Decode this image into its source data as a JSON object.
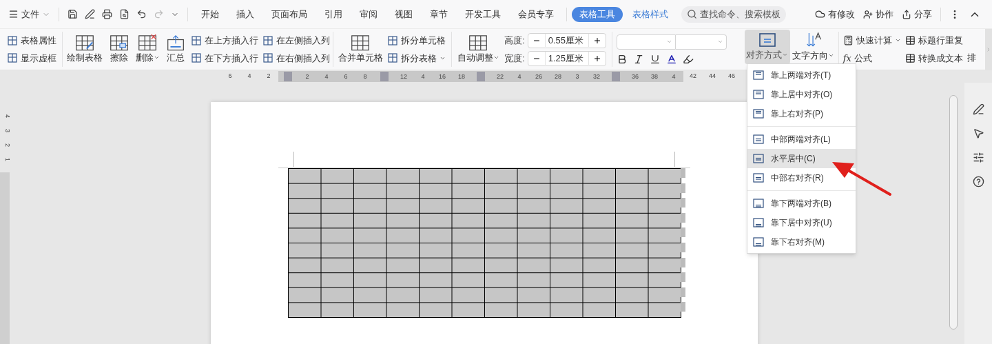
{
  "menu": {
    "file": "文件",
    "tabs": [
      {
        "label": "开始",
        "selected": false,
        "kind": "normal"
      },
      {
        "label": "插入",
        "selected": false,
        "kind": "normal"
      },
      {
        "label": "页面布局",
        "selected": false,
        "kind": "normal"
      },
      {
        "label": "引用",
        "selected": false,
        "kind": "normal"
      },
      {
        "label": "审阅",
        "selected": false,
        "kind": "normal"
      },
      {
        "label": "视图",
        "selected": false,
        "kind": "normal"
      },
      {
        "label": "章节",
        "selected": false,
        "kind": "normal"
      },
      {
        "label": "开发工具",
        "selected": false,
        "kind": "normal"
      },
      {
        "label": "会员专享",
        "selected": false,
        "kind": "normal"
      },
      {
        "label": "表格工具",
        "selected": true,
        "kind": "contextual"
      },
      {
        "label": "表格样式",
        "selected": false,
        "kind": "contextual"
      }
    ],
    "search_placeholder": "查找命令、搜索模板",
    "modified": "有修改",
    "collaborate": "协作",
    "share": "分享"
  },
  "ribbon": {
    "table_properties": "表格属性",
    "show_gridlines": "显示虚框",
    "draw_table": "绘制表格",
    "erase": "擦除",
    "delete": "删除",
    "summary": "汇总",
    "insert_above": "在上方插入行",
    "insert_below": "在下方插入行",
    "insert_left": "在左侧插入列",
    "insert_right": "在右侧插入列",
    "merge_cells": "合并单元格",
    "split_cells": "拆分单元格",
    "split_table": "拆分表格",
    "auto_fit": "自动调整",
    "height_label": "高度:",
    "height_value": "0.55厘米",
    "width_label": "宽度:",
    "width_value": "1.25厘米",
    "align": {
      "label": "对齐方式",
      "expanded": true
    },
    "text_direction": "文字方向",
    "quick_calc": "快速计算",
    "formula_mark": "fx",
    "formula": "公式",
    "repeat_header": "标题行重复",
    "convert_text": "转换成文本",
    "sort": "排"
  },
  "ruler": [
    {
      "kind": "number",
      "label": "6"
    },
    {
      "kind": "number",
      "label": "4"
    },
    {
      "kind": "number",
      "label": "2"
    },
    {
      "kind": "marker"
    },
    {
      "kind": "number",
      "label": "2"
    },
    {
      "kind": "number",
      "label": "4"
    },
    {
      "kind": "number",
      "label": "6"
    },
    {
      "kind": "number",
      "label": "8"
    },
    {
      "kind": "marker"
    },
    {
      "kind": "number",
      "label": "12"
    },
    {
      "kind": "number",
      "label": "4"
    },
    {
      "kind": "number",
      "label": "16"
    },
    {
      "kind": "number",
      "label": "18"
    },
    {
      "kind": "marker"
    },
    {
      "kind": "number",
      "label": "22"
    },
    {
      "kind": "number",
      "label": "4"
    },
    {
      "kind": "number",
      "label": "26"
    },
    {
      "kind": "number",
      "label": "28"
    },
    {
      "kind": "number",
      "label": "3"
    },
    {
      "kind": "number",
      "label": "32"
    },
    {
      "kind": "marker"
    },
    {
      "kind": "number",
      "label": "36"
    },
    {
      "kind": "number",
      "label": "38"
    },
    {
      "kind": "number",
      "label": "4"
    },
    {
      "kind": "number",
      "label": "42"
    },
    {
      "kind": "number",
      "label": "44"
    },
    {
      "kind": "number",
      "label": "46"
    }
  ],
  "vertical_ruler": [
    "4",
    "3",
    "2",
    "1"
  ],
  "align_menu": [
    [
      {
        "label": "靠上两端对齐(T)",
        "selected": false
      },
      {
        "label": "靠上居中对齐(O)",
        "selected": false
      },
      {
        "label": "靠上右对齐(P)",
        "selected": false
      }
    ],
    [
      {
        "label": "中部两端对齐(L)",
        "selected": false
      },
      {
        "label": "水平居中(C)",
        "selected": true
      },
      {
        "label": "中部右对齐(R)",
        "selected": false
      }
    ],
    [
      {
        "label": "靠下两端对齐(B)",
        "selected": false
      },
      {
        "label": "靠下居中对齐(U)",
        "selected": false
      },
      {
        "label": "靠下右对齐(M)",
        "selected": false
      }
    ]
  ]
}
